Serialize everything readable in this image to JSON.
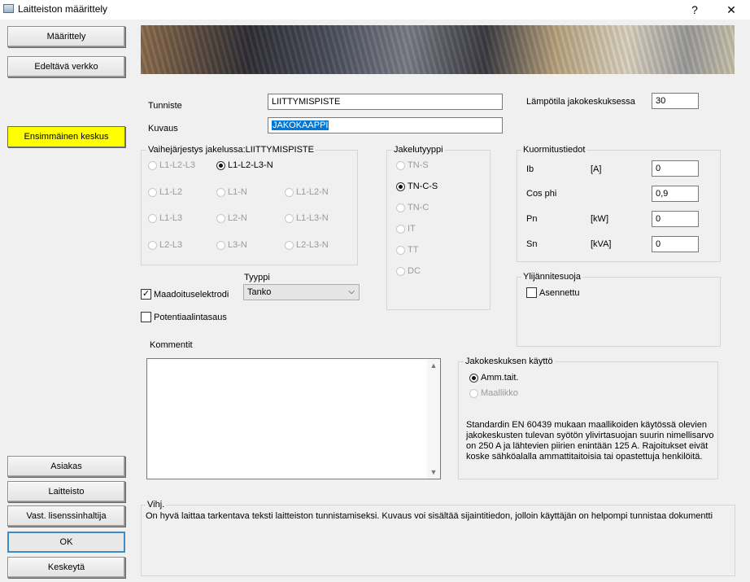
{
  "window": {
    "title": "Laitteiston määrittely",
    "help": "?",
    "close": "✕"
  },
  "left_buttons": {
    "maarittely": "Määrittely",
    "edeltava": "Edeltävä verkko",
    "ensimmainen": "Ensimmäinen keskus",
    "asiakas": "Asiakas",
    "laitteisto": "Laitteisto",
    "lisenssi": "Vast. lisenssinhaltija",
    "ok": "OK",
    "keskeyta": "Keskeytä"
  },
  "form": {
    "tunniste_label": "Tunniste",
    "tunniste_value": "LIITTYMISPISTE",
    "kuvaus_label": "Kuvaus",
    "kuvaus_value": "JAKOKAAPPI",
    "lampotila_label": "Lämpötila jakokeskuksessa",
    "lampotila_value": "30"
  },
  "phase_group": {
    "legend": "Vaihejärjestys jakelussa:LIITTYMISPISTE",
    "options": [
      "L1-L2-L3",
      "L1-L2-L3-N",
      "L1-L2",
      "L1-N",
      "L1-L2-N",
      "L1-L3",
      "L2-N",
      "L1-L3-N",
      "L2-L3",
      "L3-N",
      "L2-L3-N"
    ]
  },
  "jakelu_group": {
    "legend": "Jakelutyyppi",
    "options": [
      "TN-S",
      "TN-C-S",
      "TN-C",
      "IT",
      "TT",
      "DC"
    ]
  },
  "kuormitus_group": {
    "legend": "Kuormitustiedot",
    "ib_label": "Ib",
    "ib_unit": "[A]",
    "ib_value": "0",
    "cosphi_label": "Cos phi",
    "cosphi_value": "0,9",
    "pn_label": "Pn",
    "pn_unit": "[kW]",
    "pn_value": "0",
    "sn_label": "Sn",
    "sn_unit": "[kVA]",
    "sn_value": "0"
  },
  "maadoitus": {
    "label": "Maadoituselektrodi",
    "tyyppi_label": "Tyyppi",
    "tyyppi_value": "Tanko"
  },
  "potentiaali": {
    "label": "Potentiaalintasaus"
  },
  "ylijannite": {
    "legend": "Ylijännitesuoja",
    "label": "Asennettu"
  },
  "kommentit": {
    "label": "Kommentit",
    "value": ""
  },
  "kaytto_group": {
    "legend": "Jakokeskuksen käyttö",
    "opt1": "Amm.tait.",
    "opt2": "Maallikko",
    "note1": "Standardin EN 60439 mukaan maallikoiden käytössä olevien",
    "note2": "jakokeskusten  tulevan syötön ylivirtasuojan suurin nimellisarvo",
    "note3": "on 250 A ja lähtevien piirien enintään 125 A. Rajoitukset eivät",
    "note4": "koske sähköalalla ammattitaitoisia tai opastettuja henkilöitä."
  },
  "hint": {
    "legend": "Vihj.",
    "text": "On hyvä laittaa tarkentava teksti laitteiston tunnistamiseksi. Kuvaus voi sisältää sijaintitiedon, jolloin käyttäjän on helpompi tunnistaa dokumentti"
  },
  "icons": {
    "window": "window-icon",
    "check": "checkmark-icon",
    "dropdown": "chevron-down-icon"
  }
}
